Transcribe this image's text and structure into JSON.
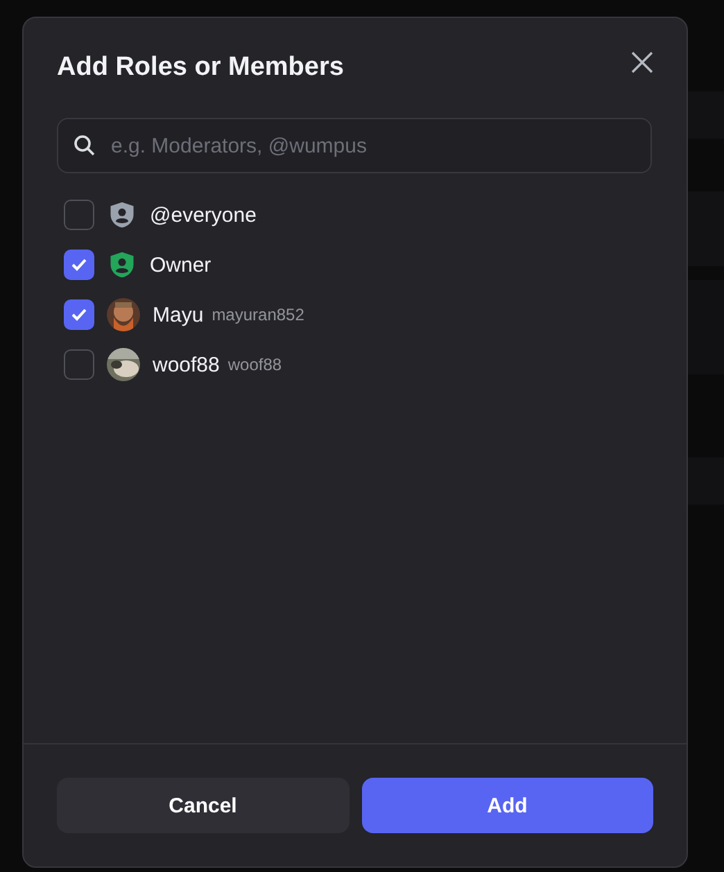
{
  "dialog": {
    "title": "Add Roles or Members"
  },
  "search": {
    "placeholder": "e.g. Moderators, @wumpus"
  },
  "items": [
    {
      "kind": "role",
      "name": "@everyone",
      "checked": false,
      "color": "#9aa3ad"
    },
    {
      "kind": "role",
      "name": "Owner",
      "checked": true,
      "color": "#23a55a"
    },
    {
      "kind": "member",
      "name": "Mayu",
      "username": "mayuran852",
      "checked": true
    },
    {
      "kind": "member",
      "name": "woof88",
      "username": "woof88",
      "checked": false
    }
  ],
  "buttons": [
    {
      "kind": "secondary",
      "label": "Cancel"
    },
    {
      "kind": "primary",
      "label": "Add"
    }
  ]
}
